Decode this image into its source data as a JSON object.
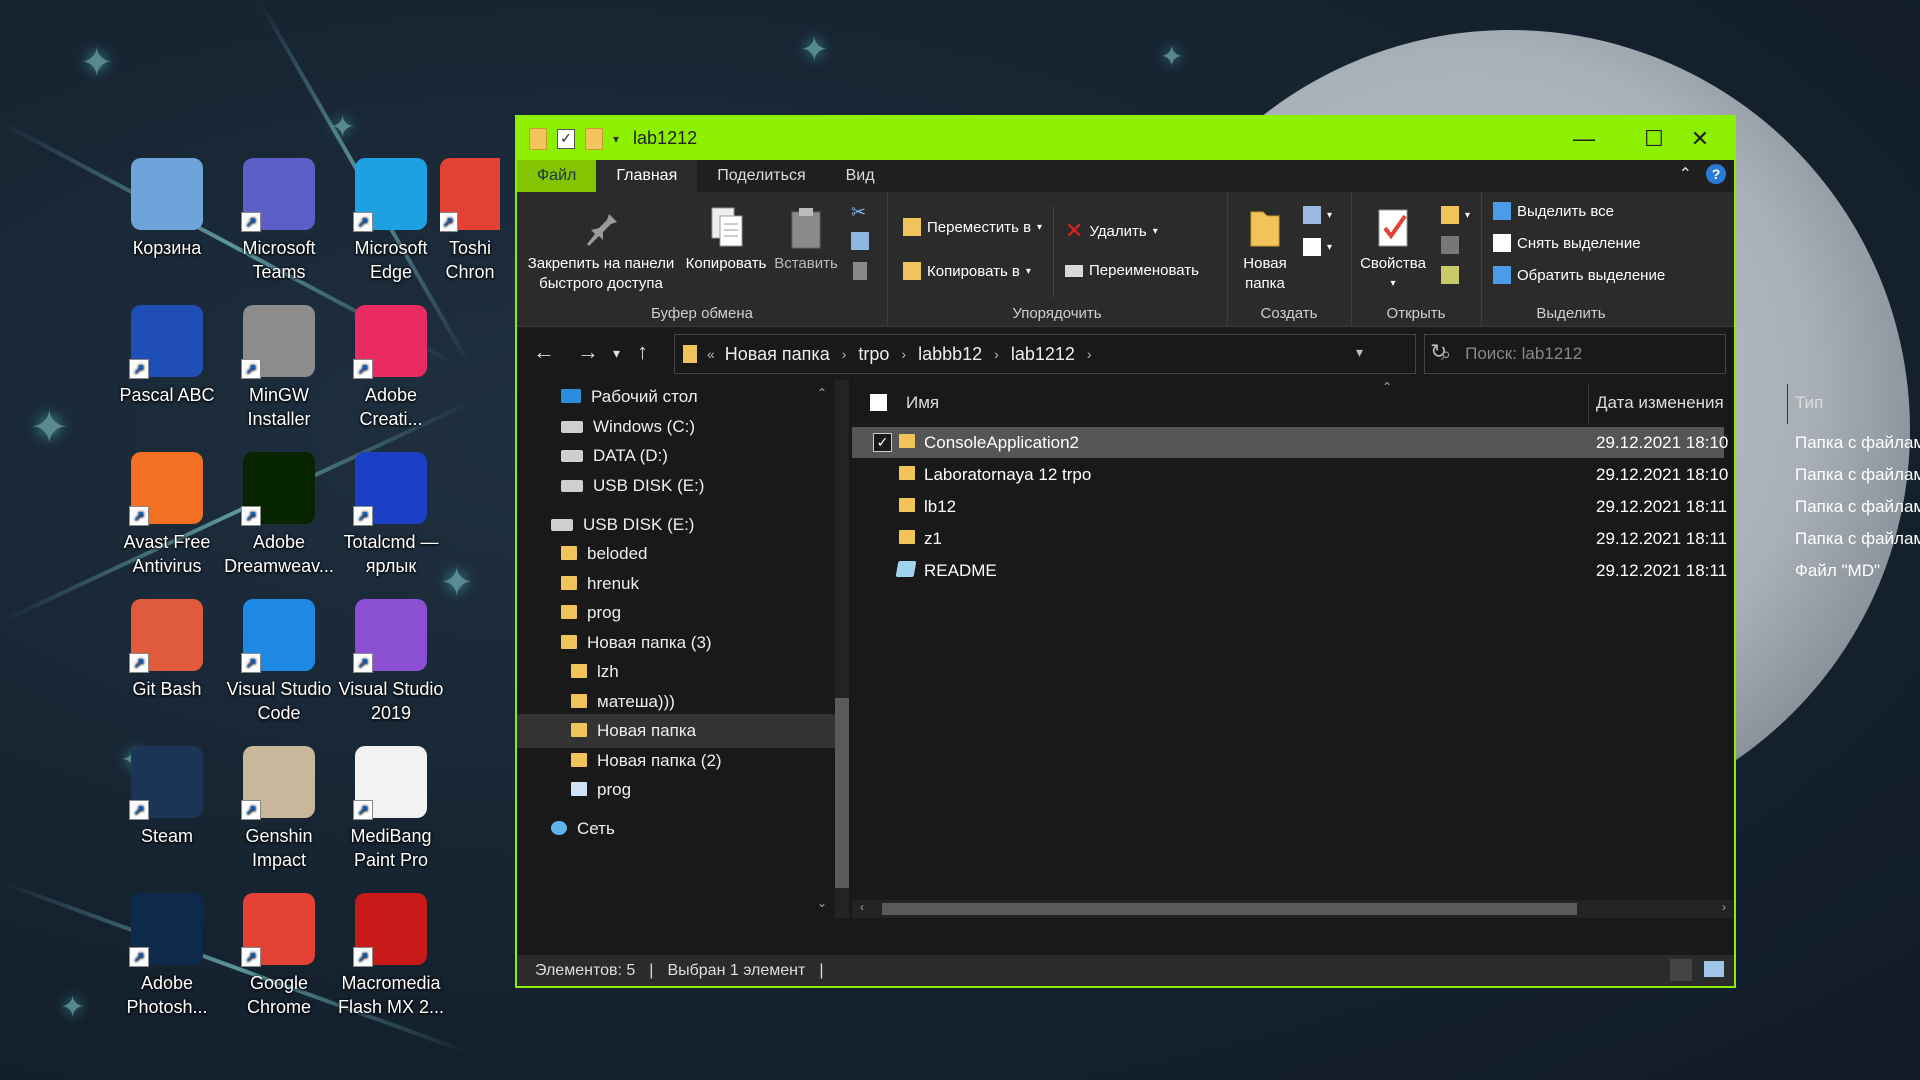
{
  "desktop": {
    "icons": [
      {
        "label": "Корзина",
        "icon": "recycle-bin-icon",
        "color": "#6ea4d9"
      },
      {
        "label": "Microsoft Teams",
        "icon": "teams-icon",
        "color": "#5b5fc7"
      },
      {
        "label": "Microsoft Edge",
        "icon": "edge-icon",
        "color": "#1da1e2"
      },
      {
        "label": "Toshi Chron",
        "icon": "chrome-icon",
        "color": "#e34133"
      },
      {
        "label": "Pascal ABC",
        "icon": "pascal-abc-icon",
        "color": "#1f4fb6"
      },
      {
        "label": "MinGW Installer",
        "icon": "mingw-icon",
        "color": "#8c8c8c"
      },
      {
        "label": "Adobe Creati...",
        "icon": "creative-cloud-icon",
        "color": "#ea2b61"
      },
      {
        "label": "Avast Free Antivirus",
        "icon": "avast-icon",
        "color": "#f36f21"
      },
      {
        "label": "Adobe Dreamweav...",
        "icon": "dreamweaver-icon",
        "color": "#072401"
      },
      {
        "label": "Totalcmd — ярлык",
        "icon": "totalcmd-icon",
        "color": "#1b3fc5"
      },
      {
        "label": "Git Bash",
        "icon": "git-bash-icon",
        "color": "#e05b3c"
      },
      {
        "label": "Visual Studio Code",
        "icon": "vscode-icon",
        "color": "#1e88e5"
      },
      {
        "label": "Visual Studio 2019",
        "icon": "visual-studio-icon",
        "color": "#8a4fd3"
      },
      {
        "label": "Steam",
        "icon": "steam-icon",
        "color": "#1b3556"
      },
      {
        "label": "Genshin Impact",
        "icon": "genshin-icon",
        "color": "#c8b79a"
      },
      {
        "label": "MediBang Paint Pro",
        "icon": "medibang-icon",
        "color": "#f2f2f2"
      },
      {
        "label": "Adobe Photosh...",
        "icon": "photoshop-icon",
        "color": "#0d2a4a"
      },
      {
        "label": "Google Chrome",
        "icon": "chrome-icon",
        "color": "#e34133"
      },
      {
        "label": "Macromedia Flash MX 2...",
        "icon": "flash-icon",
        "color": "#c91a1a"
      }
    ]
  },
  "window": {
    "title": "lab1212",
    "accent": "#8cf000",
    "controls": {
      "minimize": "—",
      "maximize": "☐",
      "close": "✕"
    },
    "tabs": {
      "file": "Файл",
      "home": "Главная",
      "share": "Поделиться",
      "view": "Вид"
    },
    "help": "?",
    "ribbon": {
      "clipboard": {
        "group": "Буфер обмена",
        "pin": "Закрепить на панели быстрого доступа",
        "copy": "Копировать",
        "paste": "Вставить"
      },
      "organize": {
        "group": "Упорядочить",
        "move": "Переместить в",
        "copyto": "Копировать в",
        "delete": "Удалить",
        "rename": "Переименовать"
      },
      "create": {
        "group": "Создать",
        "newfolder": "Новая папка"
      },
      "open": {
        "group": "Открыть",
        "properties": "Свойства"
      },
      "select": {
        "group": "Выделить",
        "all": "Выделить все",
        "none": "Снять выделение",
        "invert": "Обратить выделение"
      }
    },
    "address": {
      "crumbs": [
        "Новая папка",
        "trpo",
        "labbb12",
        "lab1212"
      ],
      "search_placeholder": "Поиск: lab1212"
    },
    "tree": [
      {
        "label": "Рабочий стол",
        "kind": "desktop"
      },
      {
        "label": "Windows (C:)",
        "kind": "drive"
      },
      {
        "label": "DATA (D:)",
        "kind": "drive"
      },
      {
        "label": "USB DISK (E:)",
        "kind": "drive"
      },
      {
        "label": "USB DISK (E:)",
        "kind": "drive"
      },
      {
        "label": "beloded",
        "kind": "folder"
      },
      {
        "label": "hrenuk",
        "kind": "folder"
      },
      {
        "label": "prog",
        "kind": "folder"
      },
      {
        "label": "Новая папка (3)",
        "kind": "folder"
      },
      {
        "label": "lzh",
        "kind": "folder"
      },
      {
        "label": "матеша)))",
        "kind": "folder"
      },
      {
        "label": "Новая папка",
        "kind": "folder",
        "selected": true
      },
      {
        "label": "Новая папка (2)",
        "kind": "folder"
      },
      {
        "label": "prog",
        "kind": "app"
      },
      {
        "label": "Сеть",
        "kind": "network"
      }
    ],
    "columns": {
      "name": "Имя",
      "date": "Дата изменения",
      "type": "Тип"
    },
    "files": [
      {
        "name": "ConsoleApplication2",
        "date": "29.12.2021 18:10",
        "type": "Папка с файлами",
        "kind": "folder",
        "selected": true
      },
      {
        "name": "Laboratornaya 12 trpo",
        "date": "29.12.2021 18:10",
        "type": "Папка с файлами",
        "kind": "folder"
      },
      {
        "name": "lb12",
        "date": "29.12.2021 18:11",
        "type": "Папка с файлами",
        "kind": "folder"
      },
      {
        "name": "z1",
        "date": "29.12.2021 18:11",
        "type": "Папка с файлами",
        "kind": "folder"
      },
      {
        "name": "README",
        "date": "29.12.2021 18:11",
        "type": "Файл \"MD\"",
        "kind": "md"
      }
    ],
    "status": {
      "count": "Элементов: 5",
      "selected": "Выбран 1 элемент"
    }
  }
}
